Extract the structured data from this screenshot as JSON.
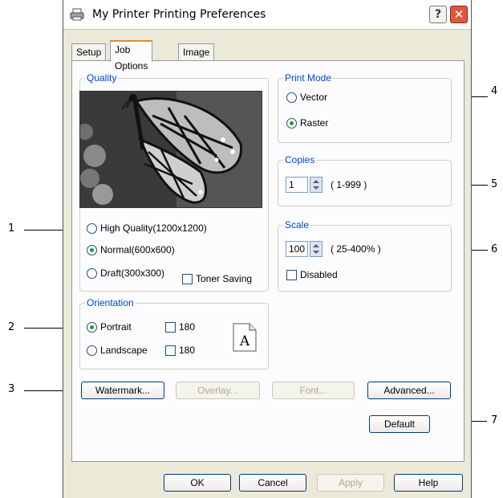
{
  "window": {
    "title": "My Printer Printing Preferences",
    "help_glyph": "?",
    "close_glyph": "✕"
  },
  "tabs": [
    {
      "label": "Setup",
      "active": false
    },
    {
      "label": "Job Options",
      "active": true
    },
    {
      "label": "Image",
      "active": false
    }
  ],
  "quality": {
    "group_label": "Quality",
    "options": [
      {
        "label": "High Quality(1200x1200)",
        "selected": false
      },
      {
        "label": "Normal(600x600)",
        "selected": true
      },
      {
        "label": "Draft(300x300)",
        "selected": false
      }
    ],
    "toner_saving": {
      "label": "Toner Saving",
      "checked": false
    }
  },
  "orientation": {
    "group_label": "Orientation",
    "portrait": {
      "label": "Portrait",
      "selected": true
    },
    "landscape": {
      "label": "Landscape",
      "selected": false
    },
    "rotate_180_portrait": {
      "label": "180",
      "checked": false
    },
    "rotate_180_landscape": {
      "label": "180",
      "checked": false
    },
    "icon_letter": "A"
  },
  "print_mode": {
    "group_label": "Print Mode",
    "vector": {
      "label": "Vector",
      "selected": false
    },
    "raster": {
      "label": "Raster",
      "selected": true
    }
  },
  "copies": {
    "group_label": "Copies",
    "value": "1",
    "range": "( 1-999 )"
  },
  "scale": {
    "group_label": "Scale",
    "value": "100",
    "range": "( 25-400% )",
    "disabled": {
      "label": "Disabled",
      "checked": false
    }
  },
  "buttons": {
    "watermark": "Watermark...",
    "overlay": "Overlay...",
    "font": "Font...",
    "advanced": "Advanced...",
    "default": "Default",
    "ok": "OK",
    "cancel": "Cancel",
    "apply": "Apply",
    "help": "Help"
  },
  "callouts": [
    "1",
    "2",
    "3",
    "4",
    "5",
    "6",
    "7"
  ],
  "colors": {
    "group_label": "#0046d5",
    "active_tab_accent": "#e68b2c",
    "radio_dot": "#21a121",
    "close_button": "#e0583a"
  }
}
